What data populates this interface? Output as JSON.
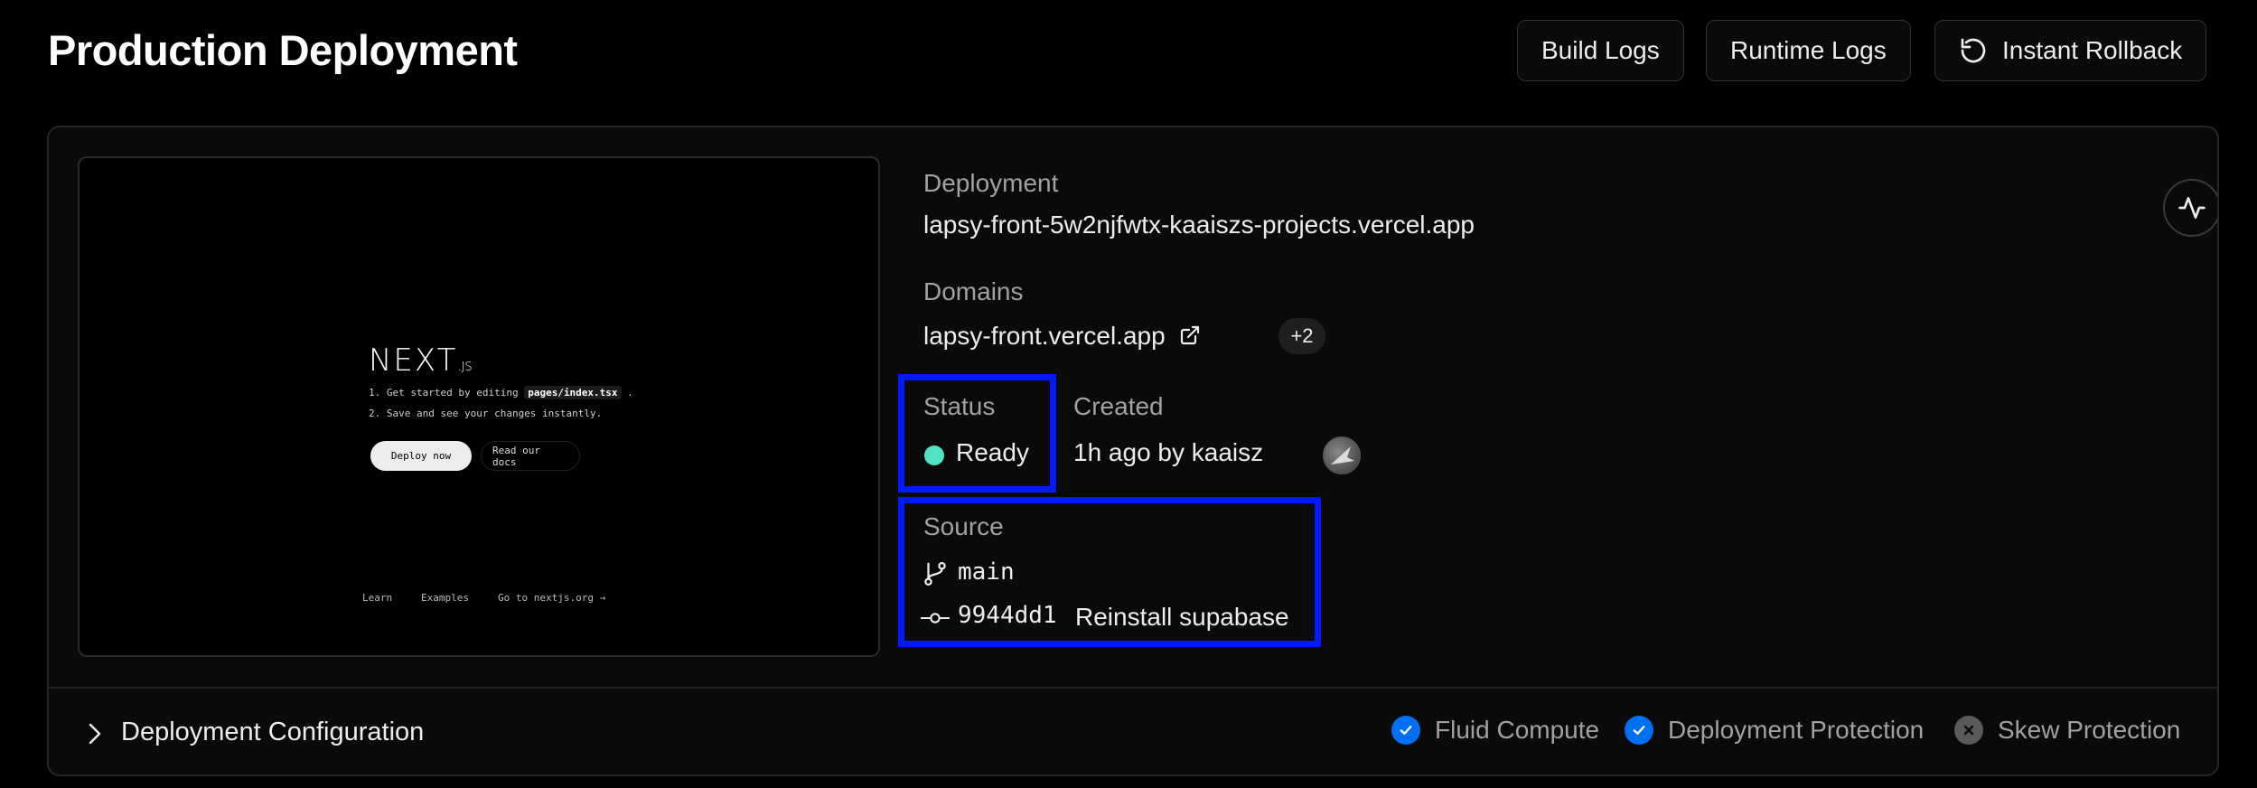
{
  "header": {
    "title": "Production Deployment",
    "buttons": {
      "build_logs": "Build Logs",
      "runtime_logs": "Runtime Logs",
      "instant_rollback": "Instant Rollback"
    }
  },
  "preview": {
    "logo_text": "NEXT",
    "logo_suffix": ".JS",
    "step1_prefix": "1. Get started by editing",
    "step1_code": "pages/index.tsx",
    "step1_suffix": ".",
    "step2": "2. Save and see your changes instantly.",
    "deploy_label": "Deploy now",
    "docs_line1": "Read our",
    "docs_line2": "docs",
    "footer": [
      "Learn",
      "Examples",
      "Go to nextjs.org →"
    ]
  },
  "details": {
    "deployment_label": "Deployment",
    "deployment_url": "lapsy-front-5w2njfwtx-kaaiszs-projects.vercel.app",
    "domains_label": "Domains",
    "domain": "lapsy-front.vercel.app",
    "domain_extra": "+2",
    "status_label": "Status",
    "status_value": "Ready",
    "status_color": "#50e3c2",
    "created_label": "Created",
    "created_value": "1h ago by kaaisz",
    "source_label": "Source",
    "branch": "main",
    "commit_hash": "9944dd1",
    "commit_message": "Reinstall supabase"
  },
  "config": {
    "title": "Deployment Configuration",
    "features": [
      {
        "label": "Fluid Compute",
        "enabled": true
      },
      {
        "label": "Deployment Protection",
        "enabled": true
      },
      {
        "label": "Skew Protection",
        "enabled": false
      }
    ]
  },
  "colors": {
    "accent": "#0070f3",
    "highlight": "#0019ff",
    "ready": "#50e3c2"
  }
}
